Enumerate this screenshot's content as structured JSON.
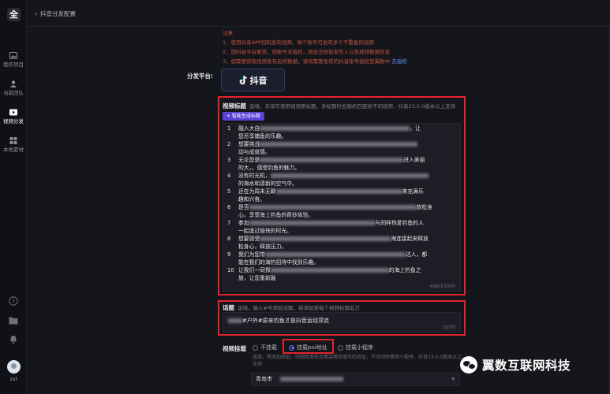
{
  "app": {
    "logo_char": "全"
  },
  "sidebar": {
    "items": [
      {
        "label": "我的项目",
        "icon": "image-icon"
      },
      {
        "label": "当前团队",
        "icon": "user-icon"
      },
      {
        "label": "视频分发",
        "icon": "video-icon"
      },
      {
        "label": "本地素材",
        "icon": "grid-icon"
      }
    ],
    "bottom_icons": [
      "help-icon",
      "folder-icon",
      "bell-icon"
    ],
    "user": {
      "name": "zxl"
    }
  },
  "header": {
    "breadcrumb": "抖音分发配置"
  },
  "notice": {
    "title": "注意:",
    "lines": [
      "1、使用抖音APP扫码发布视频，每个账号可发布多个不重复的视频",
      "2、因抖音平台要求，如账号未授权，则无法获取发布人以及视频数据信息",
      "3、如需要获取视频发布后的数据，请将需要发布的抖音账号授权至翼数中"
    ],
    "link": "去授权"
  },
  "distribution": {
    "label": "分发平台:",
    "platform_name": "抖音"
  },
  "video_titles": {
    "label": "视频标题",
    "hint": "选填，未填写使用视频原标题，多标题时会随机匹配给不同视频，抖音23.0.0版本以上支持",
    "ai_button": "+ 智能生成标题",
    "rows": [
      {
        "num": "1",
        "a": "融入大自",
        "b": "，让",
        "c": "您尽享捕鱼的乐趣。"
      },
      {
        "num": "2",
        "a": "想要挑战",
        "b": "",
        "c": "动与成就感。"
      },
      {
        "num": "3",
        "a": "无论您是",
        "b": "进入美丽",
        "c": "的大，，感受钓鱼的魅力。"
      },
      {
        "num": "4",
        "a": "没有时光机，",
        "b": "",
        "c": "的海水和清新的空气中。"
      },
      {
        "num": "5",
        "a": "还在为周末无聊",
        "b": "来充满乐",
        "c": "趣和兴奋。"
      },
      {
        "num": "6",
        "a": "是否",
        "b": "放松身",
        "c": "心，享受海上钓鱼的奇妙体验。"
      },
      {
        "num": "7",
        "a": "参加",
        "b": "与同样热爱钓鱼的人",
        "c": "一起度过愉快的时光。"
      },
      {
        "num": "8",
        "a": "想要感受",
        "b": "海连接起来释放",
        "c": "松身心，释放压力。"
      },
      {
        "num": "9",
        "a": "我们为您带",
        "b": "达人，都",
        "c": "能在我们的海钓招待中找到乐趣。"
      },
      {
        "num": "10",
        "a": "让我们一同探",
        "b": "的海上钓鱼之",
        "c": "旅，让您重新融"
      }
    ],
    "counter": "498/10000"
  },
  "topics": {
    "label": "话题",
    "hint": "选填，输入#号添加话题，将添加至每个视频标题后方",
    "value": "#户外#原来钓鱼才是抖音运动顶流",
    "counter": "19/50"
  },
  "video_mount": {
    "label": "视频挂载",
    "options": [
      "不挂载",
      "挂载poi地址",
      "挂载小程序"
    ],
    "selected": "挂载poi地址",
    "hint": "选填，将添加地址，则视频发布页面会携带填写的地址，不可同时携带小程序，抖音23.0.0版本以上支持",
    "city": "青岛市"
  },
  "watermark": {
    "text": "翼数互联网科技"
  }
}
